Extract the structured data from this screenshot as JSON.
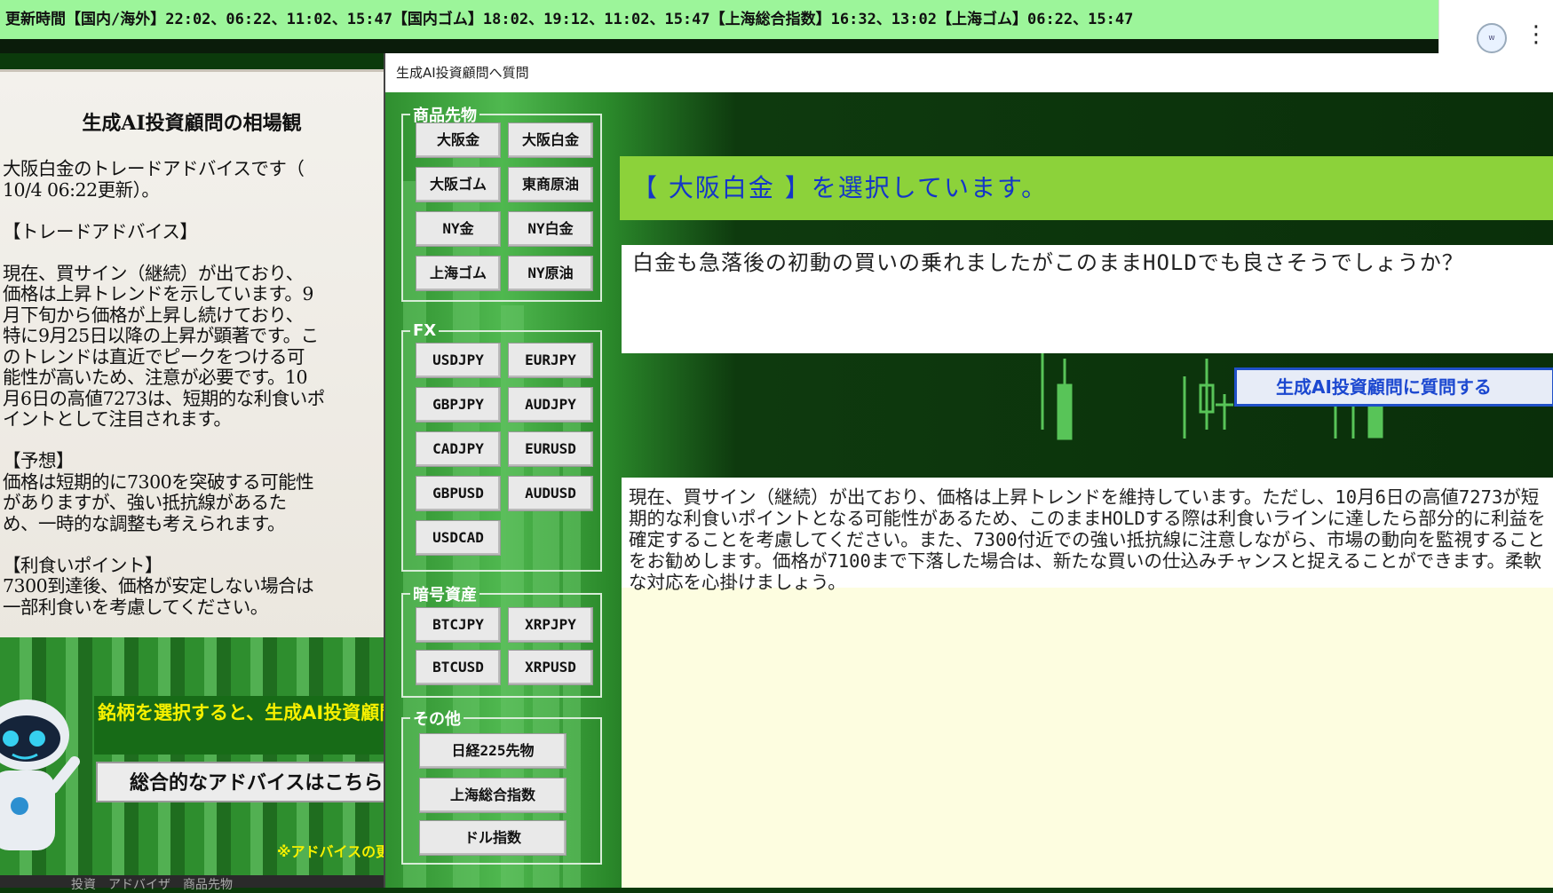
{
  "ticker": {
    "text": "更新時間【国内/海外】22:02、06:22、11:02、15:47【国内ゴム】18:02、19:12、11:02、15:47【上海総合指数】16:32、13:02【上海ゴム】06:22、15:47"
  },
  "browser": {
    "extension_icon": "winspec-extension-icon",
    "menu_icon": "kebab-menu-icon"
  },
  "left_panel": {
    "title": "生成AI投資顧問の相場観",
    "body": "大阪白金のトレードアドバイスです（\n10/4 06:22更新）。\n\n【トレードアドバイス】\n\n現在、買サイン（継続）が出ており、\n価格は上昇トレンドを示しています。9\n月下旬から価格が上昇し続けており、\n特に9月25日以降の上昇が顕著です。こ\nのトレンドは直近でピークをつける可\n能性が高いため、注意が必要です。10\n月6日の高値7273は、短期的な利食いポ\nイントとして注目されます。\n\n【予想】\n価格は短期的に7300を突破する可能性\nがありますが、強い抵抗線があるた\nめ、一時的な調整も考えられます。\n\n【利食いポイント】\n7300到達後、価格が安定しない場合は\n一部利食いを考慮してください。"
  },
  "promo": {
    "text": "銘柄を選択すると、生成AI投資顧問からのアドバイスが表示されます。",
    "button_label": "総合的なアドバイスはこちら",
    "note": "※アドバイスの更新"
  },
  "dialog": {
    "title": "生成AI投資顧問へ質問",
    "groups": {
      "commodities": {
        "legend": "商品先物",
        "items": [
          "大阪金",
          "大阪白金",
          "大阪ゴム",
          "東商原油",
          "NY金",
          "NY白金",
          "上海ゴム",
          "NY原油"
        ]
      },
      "fx": {
        "legend": "FX",
        "items": [
          "USDJPY",
          "EURJPY",
          "GBPJPY",
          "AUDJPY",
          "CADJPY",
          "EURUSD",
          "GBPUSD",
          "AUDUSD",
          "USDCAD"
        ]
      },
      "crypto": {
        "legend": "暗号資産",
        "items": [
          "BTCJPY",
          "XRPJPY",
          "BTCUSD",
          "XRPUSD"
        ]
      },
      "other": {
        "legend": "その他",
        "items": [
          "日経225先物",
          "上海総合指数",
          "ドル指数"
        ]
      }
    },
    "selected_banner": "【 大阪白金 】を選択しています。",
    "question": "白金も急落後の初動の買いの乗れましたがこのままHOLDでも良さそうでしょうか？",
    "ask_button": "生成AI投資顧問に質問する",
    "answer": "現在、買サイン（継続）が出ており、価格は上昇トレンドを維持しています。ただし、10月6日の高値7273が短期的な利食いポイントとなる可能性があるため、このままHOLDする際は利食いラインに達したら部分的に利益を確定することを考慮してください。また、7300付近での強い抵抗線に注意しながら、市場の動向を監視することをお勧めします。価格が7100まで下落した場合は、新たな買いの仕込みチャンスと捉えることができます。柔軟な対応を心掛けましょう。"
  },
  "footer": {
    "text": "投資　アドバイザ　商品先物"
  }
}
